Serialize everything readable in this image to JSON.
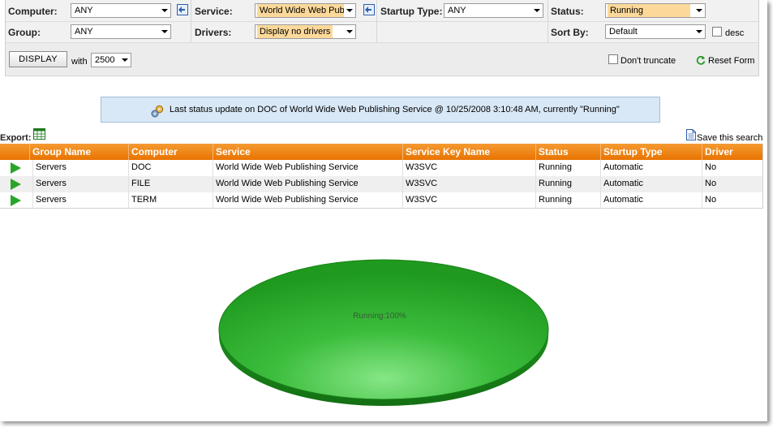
{
  "form": {
    "computer": {
      "label": "Computer:",
      "value": "ANY"
    },
    "service": {
      "label": "Service:",
      "value": "World Wide Web Pub"
    },
    "startup_type": {
      "label": "Startup Type:",
      "value": "ANY"
    },
    "status": {
      "label": "Status:",
      "value": "Running"
    },
    "group": {
      "label": "Group:",
      "value": "ANY"
    },
    "drivers": {
      "label": "Drivers:",
      "value": "Display no drivers"
    },
    "sort_by": {
      "label": "Sort By:",
      "value": "Default"
    },
    "desc_label": "desc",
    "display_button": "DISPLAY",
    "with_label": "with",
    "with_value": "2500",
    "dont_truncate_label": "Don't truncate",
    "reset_form_label": "Reset Form"
  },
  "banner": {
    "message": "Last status update on DOC of World Wide Web Publishing Service @ 10/25/2008 3:10:48 AM, currently \"Running\""
  },
  "export": {
    "label": "Export:",
    "save_search": "Save this search"
  },
  "table": {
    "columns": [
      "Group Name",
      "Computer",
      "Service",
      "Service Key Name",
      "Status",
      "Startup Type",
      "Driver"
    ],
    "rows": [
      [
        "Servers",
        "DOC",
        "World Wide Web Publishing Service",
        "W3SVC",
        "Running",
        "Automatic",
        "No"
      ],
      [
        "Servers",
        "FILE",
        "World Wide Web Publishing Service",
        "W3SVC",
        "Running",
        "Automatic",
        "No"
      ],
      [
        "Servers",
        "TERM",
        "World Wide Web Publishing Service",
        "W3SVC",
        "Running",
        "Automatic",
        "No"
      ]
    ]
  },
  "chart_data": {
    "type": "pie",
    "slices": [
      {
        "label": "Running",
        "value": 100,
        "text": "Running:100%"
      }
    ],
    "colors": [
      "#2fa52f"
    ]
  },
  "colors": {
    "accent_orange": "#e87400",
    "highlight": "#fcd99a",
    "banner_bg": "#d9e8f6",
    "pie_green": "#2fa52f"
  }
}
